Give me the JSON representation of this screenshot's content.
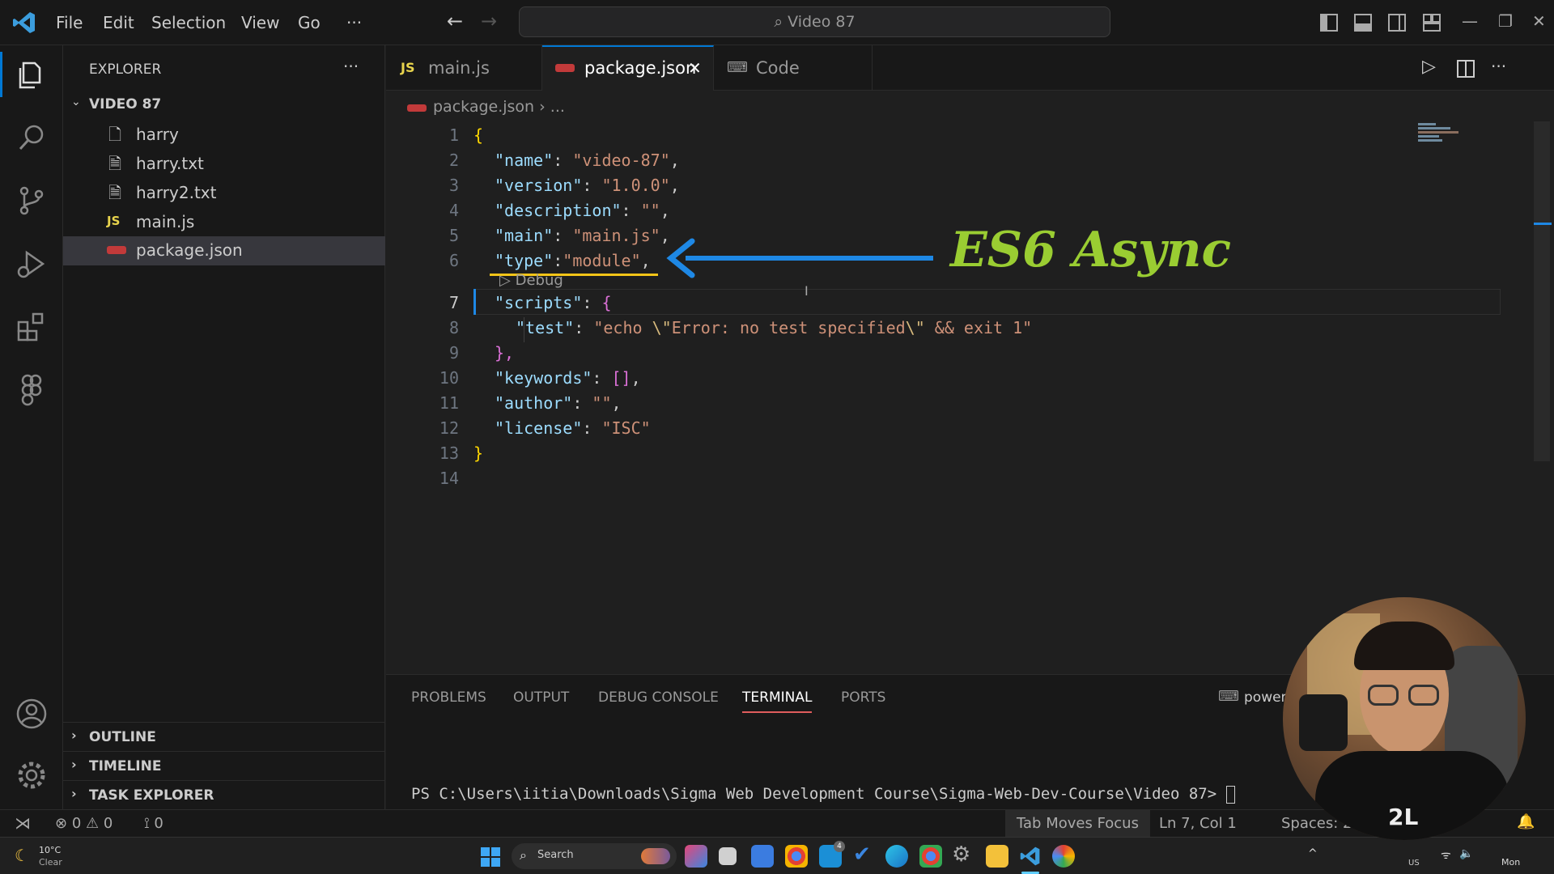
{
  "titlebar": {
    "menus": [
      "File",
      "Edit",
      "Selection",
      "View",
      "Go",
      "···"
    ],
    "search_text": "Video 87"
  },
  "sidebar": {
    "header": "EXPLORER",
    "folder": "VIDEO 87",
    "files": [
      {
        "name": "harry",
        "icon": "file-icon"
      },
      {
        "name": "harry.txt",
        "icon": "text-file-icon"
      },
      {
        "name": "harry2.txt",
        "icon": "text-file-icon"
      },
      {
        "name": "main.js",
        "icon": "js-file-icon"
      },
      {
        "name": "package.json",
        "icon": "json-file-icon"
      }
    ],
    "sections": [
      "OUTLINE",
      "TIMELINE",
      "TASK EXPLORER"
    ]
  },
  "tabs": [
    {
      "label": "main.js",
      "prefix": "JS"
    },
    {
      "label": "package.json"
    },
    {
      "label": "Code"
    }
  ],
  "breadcrumb": {
    "file": "package.json",
    "tail": "..."
  },
  "editor": {
    "lines": [
      "1",
      "2",
      "3",
      "4",
      "5",
      "6",
      "7",
      "8",
      "9",
      "10",
      "11",
      "12",
      "13",
      "14"
    ],
    "debug_lens": "Debug",
    "code": {
      "l1": "{",
      "l2k": "\"name\"",
      "l2v": "\"video-87\"",
      "l3k": "\"version\"",
      "l3v": "\"1.0.0\"",
      "l4k": "\"description\"",
      "l4v": "\"\"",
      "l5k": "\"main\"",
      "l5v": "\"main.js\"",
      "l6k": "\"type\"",
      "l6v": "\"module\"",
      "l7k": "\"scripts\"",
      "l7b": "{",
      "l8k": "\"test\"",
      "l8v1": "\"echo ",
      "l8e1": "\\\"",
      "l8v2": "Error: no test specified",
      "l8e2": "\\\"",
      "l8v3": " && exit 1\"",
      "l9": "},",
      "l10k": "\"keywords\"",
      "l10v": "[]",
      "l11k": "\"author\"",
      "l11v": "\"\"",
      "l12k": "\"license\"",
      "l12v": "\"ISC\"",
      "l13": "}"
    },
    "annotation": "ES6 Async"
  },
  "panel": {
    "tabs": [
      "PROBLEMS",
      "OUTPUT",
      "DEBUG CONSOLE",
      "TERMINAL",
      "PORTS"
    ],
    "active": "TERMINAL",
    "shell": "powers",
    "prompt": "PS C:\\Users\\iitia\\Downloads\\Sigma Web Development Course\\Sigma-Web-Dev-Course\\Video 87> "
  },
  "status": {
    "errors": "0",
    "warnings": "0",
    "ports": "0",
    "tab_focus": "Tab Moves Focus",
    "cursor": "Ln 7, Col 1",
    "spaces": "Spaces: 2"
  },
  "taskbar": {
    "weather_temp": "10°C",
    "weather_desc": "Clear",
    "search": "Search",
    "badge": "4",
    "tray_lang": "US",
    "day": "Mon"
  },
  "colors": {
    "accent": "#0078d4",
    "annotation": "#9acd32",
    "arrow": "#1e88e5",
    "underline": "#f5c518"
  }
}
